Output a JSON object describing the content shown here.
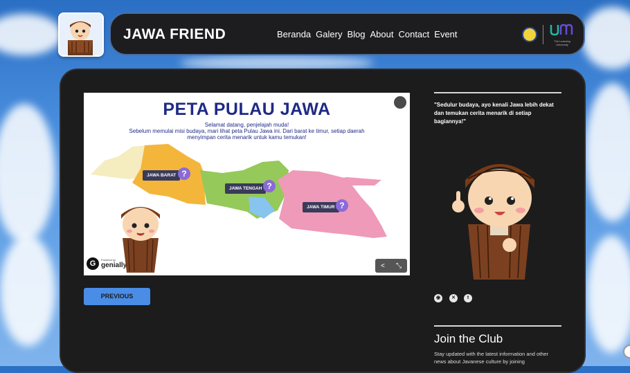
{
  "colors": {
    "navbar_bg": "#1d1d1f",
    "card_bg": "#1c1c1c",
    "accent_blue": "#4a8de6",
    "slide_title": "#1f2a86"
  },
  "header": {
    "brand": "JAWA FRIEND",
    "nav": [
      "Beranda",
      "Galery",
      "Blog",
      "About",
      "Contact",
      "Event"
    ],
    "um_logo_text": "The Learning University"
  },
  "slide": {
    "title": "PETA PULAU JAWA",
    "subtitle_line1": "Selamat datang, penjelajah muda!",
    "subtitle_line2": "Sebelum memulai misi budaya, mari lihat peta Pulau Jawa ini. Dari barat ke timur, setiap daerah",
    "subtitle_line3": "menyimpan cerita menarik untuk kamu temukan!",
    "regions": [
      "JAWA BARAT",
      "JAWA TENGAH",
      "JAWA TIMUR"
    ],
    "question_mark": "?",
    "genially_prefix": "Powered by",
    "genially_label": "genially",
    "share_icon": "share-icon",
    "fullscreen_icon": "fullscreen-icon"
  },
  "previous_button": "PREVIOUS",
  "sidebar": {
    "quote": "\"Sedulur budaya, ayo kenali Jawa lebih dekat dan temukan cerita menarik di setiap bagiannya!\"",
    "social_icons": [
      "instagram-icon",
      "x-icon",
      "tumblr-icon"
    ],
    "club_title": "Join the Club",
    "club_text": "Stay updated with the latest information and other news about Javanese culture by joining"
  }
}
